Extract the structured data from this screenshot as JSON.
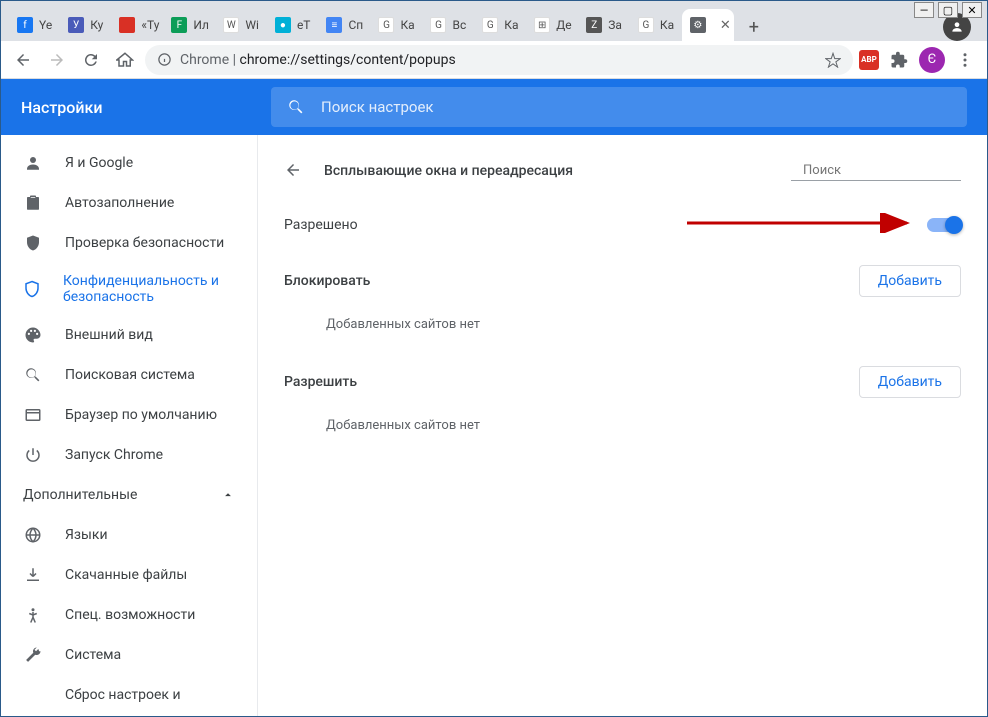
{
  "browser": {
    "tabs": [
      {
        "label": "Ye",
        "favicon_bg": "#1877f2",
        "favicon_char": "f"
      },
      {
        "label": "Ку",
        "favicon_bg": "#4a5bb9",
        "favicon_char": "У"
      },
      {
        "label": "«Ту",
        "favicon_bg": "#d93025",
        "favicon_char": ""
      },
      {
        "label": "Ил",
        "favicon_bg": "#0c9d58",
        "favicon_char": "F"
      },
      {
        "label": "Wi",
        "favicon_bg": "#fff",
        "favicon_char": "W"
      },
      {
        "label": "eT",
        "favicon_bg": "#00b0d7",
        "favicon_char": "●"
      },
      {
        "label": "Сп",
        "favicon_bg": "#4285f4",
        "favicon_char": "≡"
      },
      {
        "label": "Ка",
        "favicon_bg": "#fff",
        "favicon_char": "G"
      },
      {
        "label": "Вс",
        "favicon_bg": "#fff",
        "favicon_char": "G"
      },
      {
        "label": "Ка",
        "favicon_bg": "#fff",
        "favicon_char": "G"
      },
      {
        "label": "Де",
        "favicon_bg": "#fff",
        "favicon_char": "⊞"
      },
      {
        "label": "За",
        "favicon_bg": "#555",
        "favicon_char": "Z"
      },
      {
        "label": "Ка",
        "favicon_bg": "#fff",
        "favicon_char": "G"
      },
      {
        "label": "",
        "favicon_bg": "#5f6368",
        "favicon_char": "⚙",
        "active": true
      }
    ],
    "url_prefix": "Chrome | ",
    "url": "chrome://settings/content/popups",
    "profile_initial": "Є"
  },
  "header": {
    "title": "Настройки",
    "search_placeholder": "Поиск настроек"
  },
  "sidebar": {
    "items": [
      {
        "icon": "person",
        "label": "Я и Google"
      },
      {
        "icon": "clipboard",
        "label": "Автозаполнение"
      },
      {
        "icon": "shield-check",
        "label": "Проверка безопасности"
      },
      {
        "icon": "shield",
        "label": "Конфиденциальность и безопасность",
        "active": true
      },
      {
        "icon": "palette",
        "label": "Внешний вид"
      },
      {
        "icon": "search",
        "label": "Поисковая система"
      },
      {
        "icon": "browser",
        "label": "Браузер по умолчанию"
      },
      {
        "icon": "power",
        "label": "Запуск Chrome"
      }
    ],
    "section_label": "Дополнительные",
    "more": [
      {
        "icon": "globe",
        "label": "Языки"
      },
      {
        "icon": "download",
        "label": "Скачанные файлы"
      },
      {
        "icon": "accessibility",
        "label": "Спец. возможности"
      },
      {
        "icon": "wrench",
        "label": "Система"
      },
      {
        "icon": "",
        "label": "Сброс настроек и"
      }
    ]
  },
  "main": {
    "title": "Всплывающие окна и переадресация",
    "search_placeholder": "Поиск",
    "allowed_label": "Разрешено",
    "block_label": "Блокировать",
    "allow_label": "Разрешить",
    "add_button": "Добавить",
    "empty_text": "Добавленных сайтов нет"
  }
}
